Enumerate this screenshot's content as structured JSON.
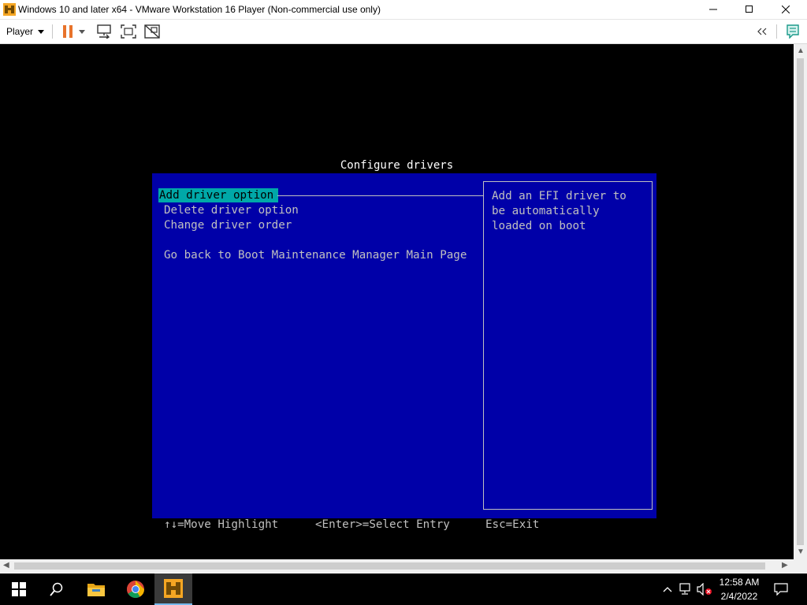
{
  "window": {
    "title": "Windows 10 and later x64 - VMware Workstation 16 Player (Non-commercial use only)",
    "controls": [
      "minimize",
      "maximize",
      "close"
    ]
  },
  "toolbar": {
    "player_label": "Player",
    "icons": [
      "pause-icon",
      "dropdown-arrow-icon",
      "send-ctrl-alt-del-icon",
      "full-screen-icon",
      "unity-icon",
      "back-arrows-icon",
      "message-log-icon"
    ]
  },
  "bios": {
    "title": "Configure drivers",
    "menu": [
      "Add driver option",
      "Delete driver option",
      "Change driver order",
      "Go back to Boot Maintenance Manager Main Page"
    ],
    "selected_index": 0,
    "help": [
      "Add an EFI driver to",
      "be automatically",
      "loaded on boot"
    ],
    "footer": {
      "move": "↑↓=Move Highlight",
      "select": "<Enter>=Select Entry",
      "exit": "Esc=Exit"
    },
    "colors": {
      "panel_bg": "#0000a8",
      "text": "#c0c0c0",
      "highlight_bg": "#00a8a8",
      "title": "#ffffff"
    }
  },
  "taskbar": {
    "apps": [
      "start-icon",
      "search-icon",
      "file-explorer-icon",
      "chrome-icon",
      "vmware-player-icon"
    ],
    "active_app": "vmware-player-icon",
    "tray": [
      "show-hidden-icons",
      "network-icon",
      "volume-muted-icon"
    ],
    "time": "12:58 AM",
    "date": "2/4/2022"
  }
}
